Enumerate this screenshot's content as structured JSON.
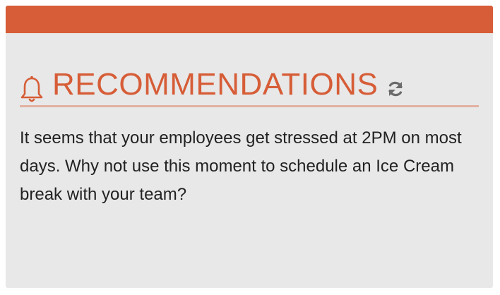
{
  "card": {
    "title": "RECOMMENDATIONS",
    "message": "It seems that your employees get stressed at 2PM on most days. Why not use this moment to schedule an Ice Cream break with your team?",
    "icons": {
      "title_icon": "bell-icon",
      "action_icon": "refresh-icon"
    }
  },
  "colors": {
    "accent": "#d65d37",
    "card_background": "#e8e8e8",
    "divider": "#e3b1a1",
    "text": "#222222",
    "icon_gray": "#6b6b6b"
  }
}
